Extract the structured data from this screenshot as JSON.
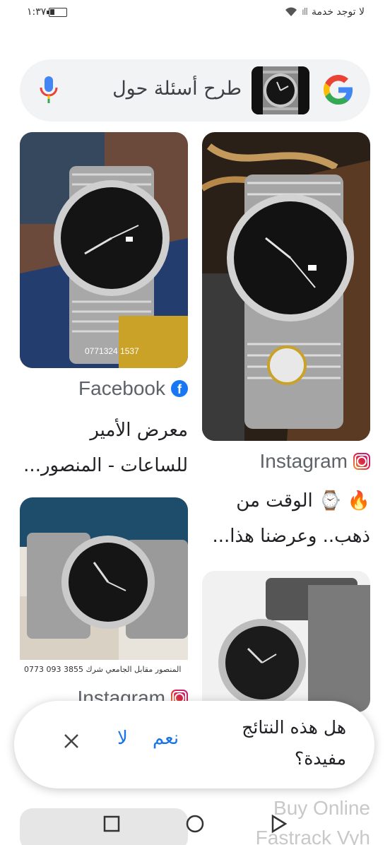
{
  "status": {
    "carrier": "لا توجد خدمة",
    "time": "١:٣٧"
  },
  "search": {
    "query": "طرح أسئلة حول"
  },
  "results": [
    {
      "source": "Facebook",
      "title_line1": "معرض الأمير",
      "title_line2": "للساعات - المنصور...",
      "watermark": "0771324 1537"
    },
    {
      "source": "Instagram",
      "title_line1": "🔥 ⌚ الوقت من",
      "title_line2": "ذهب.. وعرضنا هذا..."
    },
    {
      "source": "Instagram",
      "caption": "0773 093 3855 المنصور مقابل الجامعي شرك"
    },
    {
      "source_partial": "Buy Online",
      "source_partial2": "Fastrack Vyh"
    }
  ],
  "feedback": {
    "question": "هل هذه النتائج مفيدة؟",
    "yes": "نعم",
    "no": "لا"
  },
  "colors": {
    "google_blue": "#4285F4",
    "google_red": "#EA4335",
    "google_yellow": "#FBBC05",
    "google_green": "#34A853",
    "link_blue": "#1a73e8"
  }
}
